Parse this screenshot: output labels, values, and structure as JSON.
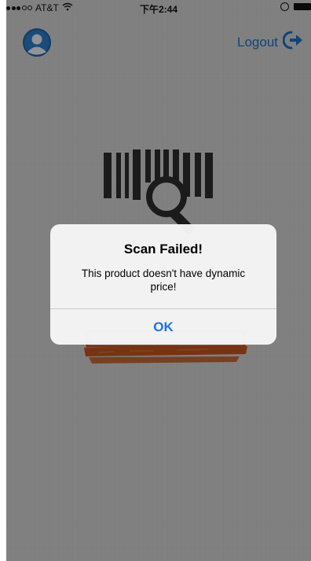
{
  "status_bar": {
    "carrier": "AT&T",
    "time": "下午2:44"
  },
  "nav": {
    "logout_label": "Logout"
  },
  "alert": {
    "title": "Scan Failed!",
    "message": "This product doesn't have dynamic price!",
    "ok_label": "OK"
  },
  "colors": {
    "accent": "#1a73e8",
    "link": "#1a6fc2",
    "receipt": "#c0531d",
    "barcode": "#2d2d2d"
  },
  "icons": {
    "avatar": "user-avatar-icon",
    "logout": "logout-arrow-icon",
    "wifi": "wifi-icon",
    "lock": "orientation-lock-icon",
    "battery": "battery-icon"
  }
}
